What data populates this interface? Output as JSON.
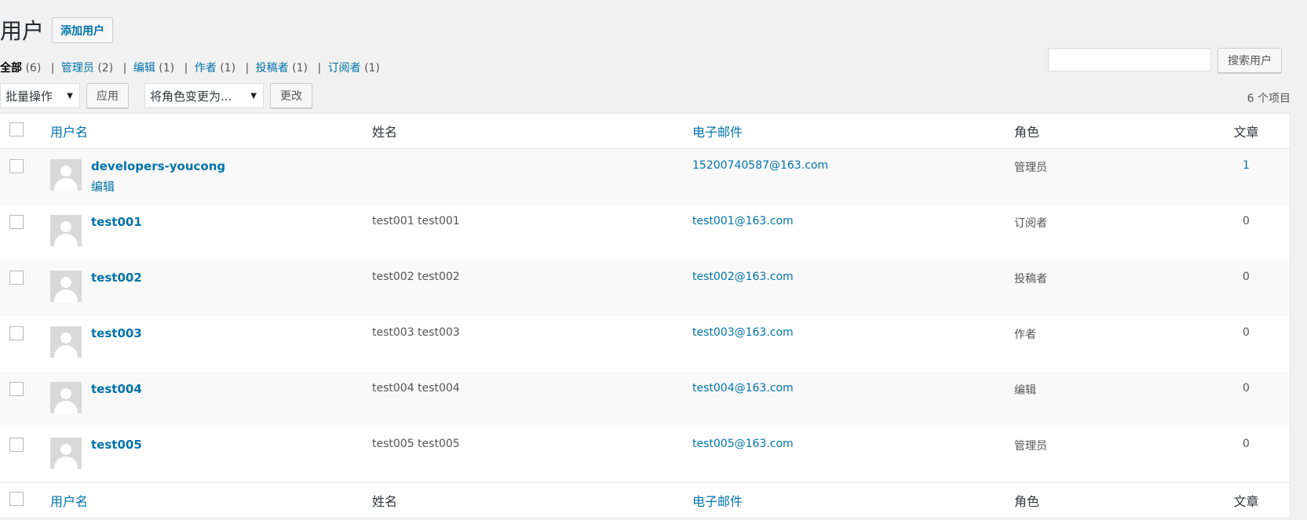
{
  "page": {
    "title": "用户",
    "add_button": "添加用户"
  },
  "filters": [
    {
      "label": "全部",
      "count": "(6)",
      "current": true
    },
    {
      "label": "管理员",
      "count": "(2)",
      "current": false
    },
    {
      "label": "编辑",
      "count": "(1)",
      "current": false
    },
    {
      "label": "作者",
      "count": "(1)",
      "current": false
    },
    {
      "label": "投稿者",
      "count": "(1)",
      "current": false
    },
    {
      "label": "订阅者",
      "count": "(1)",
      "current": false
    }
  ],
  "search": {
    "button": "搜索用户",
    "value": ""
  },
  "tablenav": {
    "bulk_select": "批量操作",
    "apply": "应用",
    "role_select": "将角色变更为...",
    "change": "更改",
    "items_count": "6 个项目"
  },
  "columns": {
    "username": "用户名",
    "name": "姓名",
    "email": "电子邮件",
    "role": "角色",
    "posts": "文章"
  },
  "users": [
    {
      "username": "developers-youcong",
      "name": "",
      "email": "15200740587@163.com",
      "role": "管理员",
      "posts": "1",
      "row_action": "编辑"
    },
    {
      "username": "test001",
      "name": "test001 test001",
      "email": "test001@163.com",
      "role": "订阅者",
      "posts": "0"
    },
    {
      "username": "test002",
      "name": "test002 test002",
      "email": "test002@163.com",
      "role": "投稿者",
      "posts": "0"
    },
    {
      "username": "test003",
      "name": "test003 test003",
      "email": "test003@163.com",
      "role": "作者",
      "posts": "0"
    },
    {
      "username": "test004",
      "name": "test004 test004",
      "email": "test004@163.com",
      "role": "编辑",
      "posts": "0"
    },
    {
      "username": "test005",
      "name": "test005 test005",
      "email": "test005@163.com",
      "role": "管理员",
      "posts": "0"
    }
  ],
  "icons": {
    "avatar": "default-avatar-icon",
    "dropdown": "dropdown-arrow-icon"
  },
  "colors": {
    "link": "#0073aa",
    "background": "#f1f1f1"
  }
}
